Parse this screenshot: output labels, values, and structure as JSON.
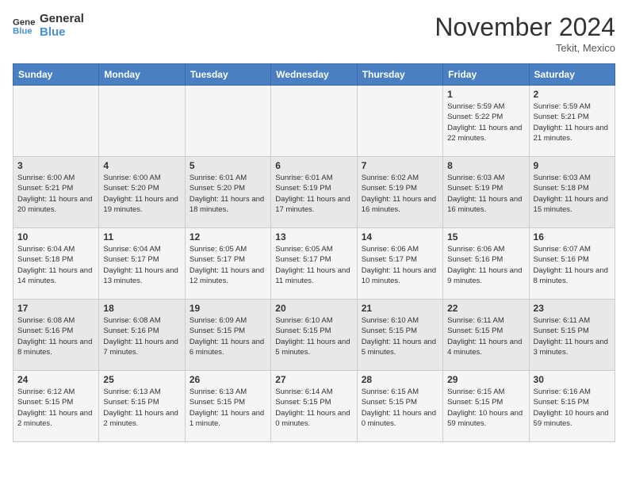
{
  "header": {
    "logo_line1": "General",
    "logo_line2": "Blue",
    "month_title": "November 2024",
    "location": "Tekit, Mexico"
  },
  "calendar": {
    "days_of_week": [
      "Sunday",
      "Monday",
      "Tuesday",
      "Wednesday",
      "Thursday",
      "Friday",
      "Saturday"
    ],
    "weeks": [
      [
        {
          "day": "",
          "info": ""
        },
        {
          "day": "",
          "info": ""
        },
        {
          "day": "",
          "info": ""
        },
        {
          "day": "",
          "info": ""
        },
        {
          "day": "",
          "info": ""
        },
        {
          "day": "1",
          "info": "Sunrise: 5:59 AM\nSunset: 5:22 PM\nDaylight: 11 hours and 22 minutes."
        },
        {
          "day": "2",
          "info": "Sunrise: 5:59 AM\nSunset: 5:21 PM\nDaylight: 11 hours and 21 minutes."
        }
      ],
      [
        {
          "day": "3",
          "info": "Sunrise: 6:00 AM\nSunset: 5:21 PM\nDaylight: 11 hours and 20 minutes."
        },
        {
          "day": "4",
          "info": "Sunrise: 6:00 AM\nSunset: 5:20 PM\nDaylight: 11 hours and 19 minutes."
        },
        {
          "day": "5",
          "info": "Sunrise: 6:01 AM\nSunset: 5:20 PM\nDaylight: 11 hours and 18 minutes."
        },
        {
          "day": "6",
          "info": "Sunrise: 6:01 AM\nSunset: 5:19 PM\nDaylight: 11 hours and 17 minutes."
        },
        {
          "day": "7",
          "info": "Sunrise: 6:02 AM\nSunset: 5:19 PM\nDaylight: 11 hours and 16 minutes."
        },
        {
          "day": "8",
          "info": "Sunrise: 6:03 AM\nSunset: 5:19 PM\nDaylight: 11 hours and 16 minutes."
        },
        {
          "day": "9",
          "info": "Sunrise: 6:03 AM\nSunset: 5:18 PM\nDaylight: 11 hours and 15 minutes."
        }
      ],
      [
        {
          "day": "10",
          "info": "Sunrise: 6:04 AM\nSunset: 5:18 PM\nDaylight: 11 hours and 14 minutes."
        },
        {
          "day": "11",
          "info": "Sunrise: 6:04 AM\nSunset: 5:17 PM\nDaylight: 11 hours and 13 minutes."
        },
        {
          "day": "12",
          "info": "Sunrise: 6:05 AM\nSunset: 5:17 PM\nDaylight: 11 hours and 12 minutes."
        },
        {
          "day": "13",
          "info": "Sunrise: 6:05 AM\nSunset: 5:17 PM\nDaylight: 11 hours and 11 minutes."
        },
        {
          "day": "14",
          "info": "Sunrise: 6:06 AM\nSunset: 5:17 PM\nDaylight: 11 hours and 10 minutes."
        },
        {
          "day": "15",
          "info": "Sunrise: 6:06 AM\nSunset: 5:16 PM\nDaylight: 11 hours and 9 minutes."
        },
        {
          "day": "16",
          "info": "Sunrise: 6:07 AM\nSunset: 5:16 PM\nDaylight: 11 hours and 8 minutes."
        }
      ],
      [
        {
          "day": "17",
          "info": "Sunrise: 6:08 AM\nSunset: 5:16 PM\nDaylight: 11 hours and 8 minutes."
        },
        {
          "day": "18",
          "info": "Sunrise: 6:08 AM\nSunset: 5:16 PM\nDaylight: 11 hours and 7 minutes."
        },
        {
          "day": "19",
          "info": "Sunrise: 6:09 AM\nSunset: 5:15 PM\nDaylight: 11 hours and 6 minutes."
        },
        {
          "day": "20",
          "info": "Sunrise: 6:10 AM\nSunset: 5:15 PM\nDaylight: 11 hours and 5 minutes."
        },
        {
          "day": "21",
          "info": "Sunrise: 6:10 AM\nSunset: 5:15 PM\nDaylight: 11 hours and 5 minutes."
        },
        {
          "day": "22",
          "info": "Sunrise: 6:11 AM\nSunset: 5:15 PM\nDaylight: 11 hours and 4 minutes."
        },
        {
          "day": "23",
          "info": "Sunrise: 6:11 AM\nSunset: 5:15 PM\nDaylight: 11 hours and 3 minutes."
        }
      ],
      [
        {
          "day": "24",
          "info": "Sunrise: 6:12 AM\nSunset: 5:15 PM\nDaylight: 11 hours and 2 minutes."
        },
        {
          "day": "25",
          "info": "Sunrise: 6:13 AM\nSunset: 5:15 PM\nDaylight: 11 hours and 2 minutes."
        },
        {
          "day": "26",
          "info": "Sunrise: 6:13 AM\nSunset: 5:15 PM\nDaylight: 11 hours and 1 minute."
        },
        {
          "day": "27",
          "info": "Sunrise: 6:14 AM\nSunset: 5:15 PM\nDaylight: 11 hours and 0 minutes."
        },
        {
          "day": "28",
          "info": "Sunrise: 6:15 AM\nSunset: 5:15 PM\nDaylight: 11 hours and 0 minutes."
        },
        {
          "day": "29",
          "info": "Sunrise: 6:15 AM\nSunset: 5:15 PM\nDaylight: 10 hours and 59 minutes."
        },
        {
          "day": "30",
          "info": "Sunrise: 6:16 AM\nSunset: 5:15 PM\nDaylight: 10 hours and 59 minutes."
        }
      ]
    ]
  }
}
